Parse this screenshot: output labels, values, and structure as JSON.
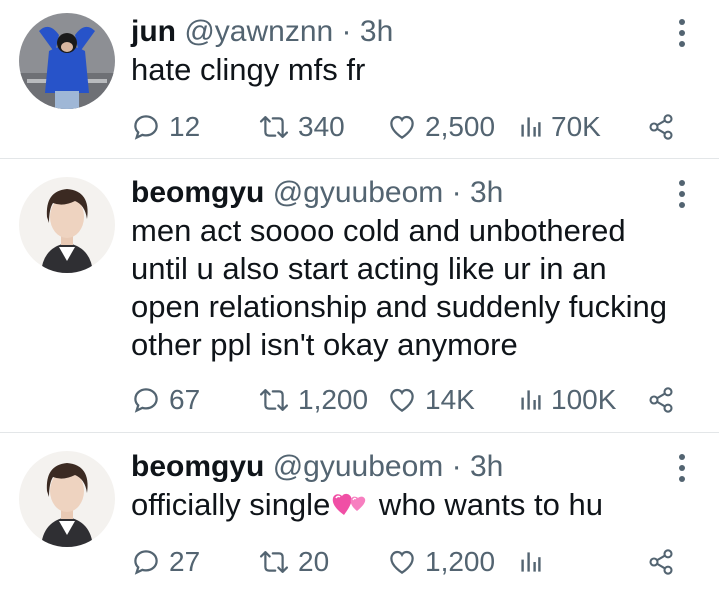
{
  "tweets": [
    {
      "name": "jun",
      "handle": "@yawnznn",
      "separator": "·",
      "time": "3h",
      "text_lines": [
        "hate clingy mfs fr"
      ],
      "replies": "12",
      "retweets": "340",
      "likes": "2,500",
      "views": "70K"
    },
    {
      "name": "beomgyu",
      "handle": "@gyuubeom",
      "separator": "·",
      "time": "3h",
      "text_lines": [
        "men act soooo cold and unbothered",
        "until u also start acting like ur in an",
        "open relationship and suddenly fucking",
        "other ppl isn't okay anymore"
      ],
      "replies": "67",
      "retweets": "1,200",
      "likes": "14K",
      "views": "100K"
    },
    {
      "name": "beomgyu",
      "handle": "@gyuubeom",
      "separator": "·",
      "time": "3h",
      "text_before_emoji": "officially single",
      "emoji": "two-hearts-emoji",
      "text_after_emoji": " who wants to hu",
      "replies": "27",
      "retweets": "20",
      "likes": "1,200",
      "views": ""
    }
  ],
  "colors": {
    "text": "#0f1419",
    "secondary": "#536471",
    "divider": "#e3e6e8",
    "avatar1_jacket": "#2753c9",
    "emoji_pink": "#f04fa5"
  }
}
